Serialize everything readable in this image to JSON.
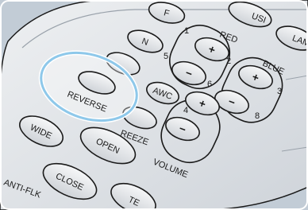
{
  "remote": {
    "buttons": {
      "f": "F",
      "n": "N",
      "usi": "USI",
      "lam": "LAM",
      "reverse": "REVERSE",
      "awc": "AWC",
      "freeze": "REEZE",
      "wide": "WIDE",
      "open": "OPEN",
      "close": "CLOSE",
      "anti_flk": "ANTI-FLK",
      "te": "TE"
    },
    "number_labels": [
      "1",
      "2",
      "3",
      "4",
      "5",
      "6",
      "8"
    ],
    "groups": {
      "red": "RED",
      "blue": "BLUE",
      "volume": "VOLUME"
    },
    "signs": {
      "plus": "+",
      "minus": "−"
    },
    "highlight": "REVERSE",
    "colors": {
      "background": "#c9d3dd",
      "remote_body": "#dfe2e6",
      "button_face": "#eceff2",
      "outline": "#1a1a1a",
      "highlight_ring": "#8ec8ea"
    }
  }
}
